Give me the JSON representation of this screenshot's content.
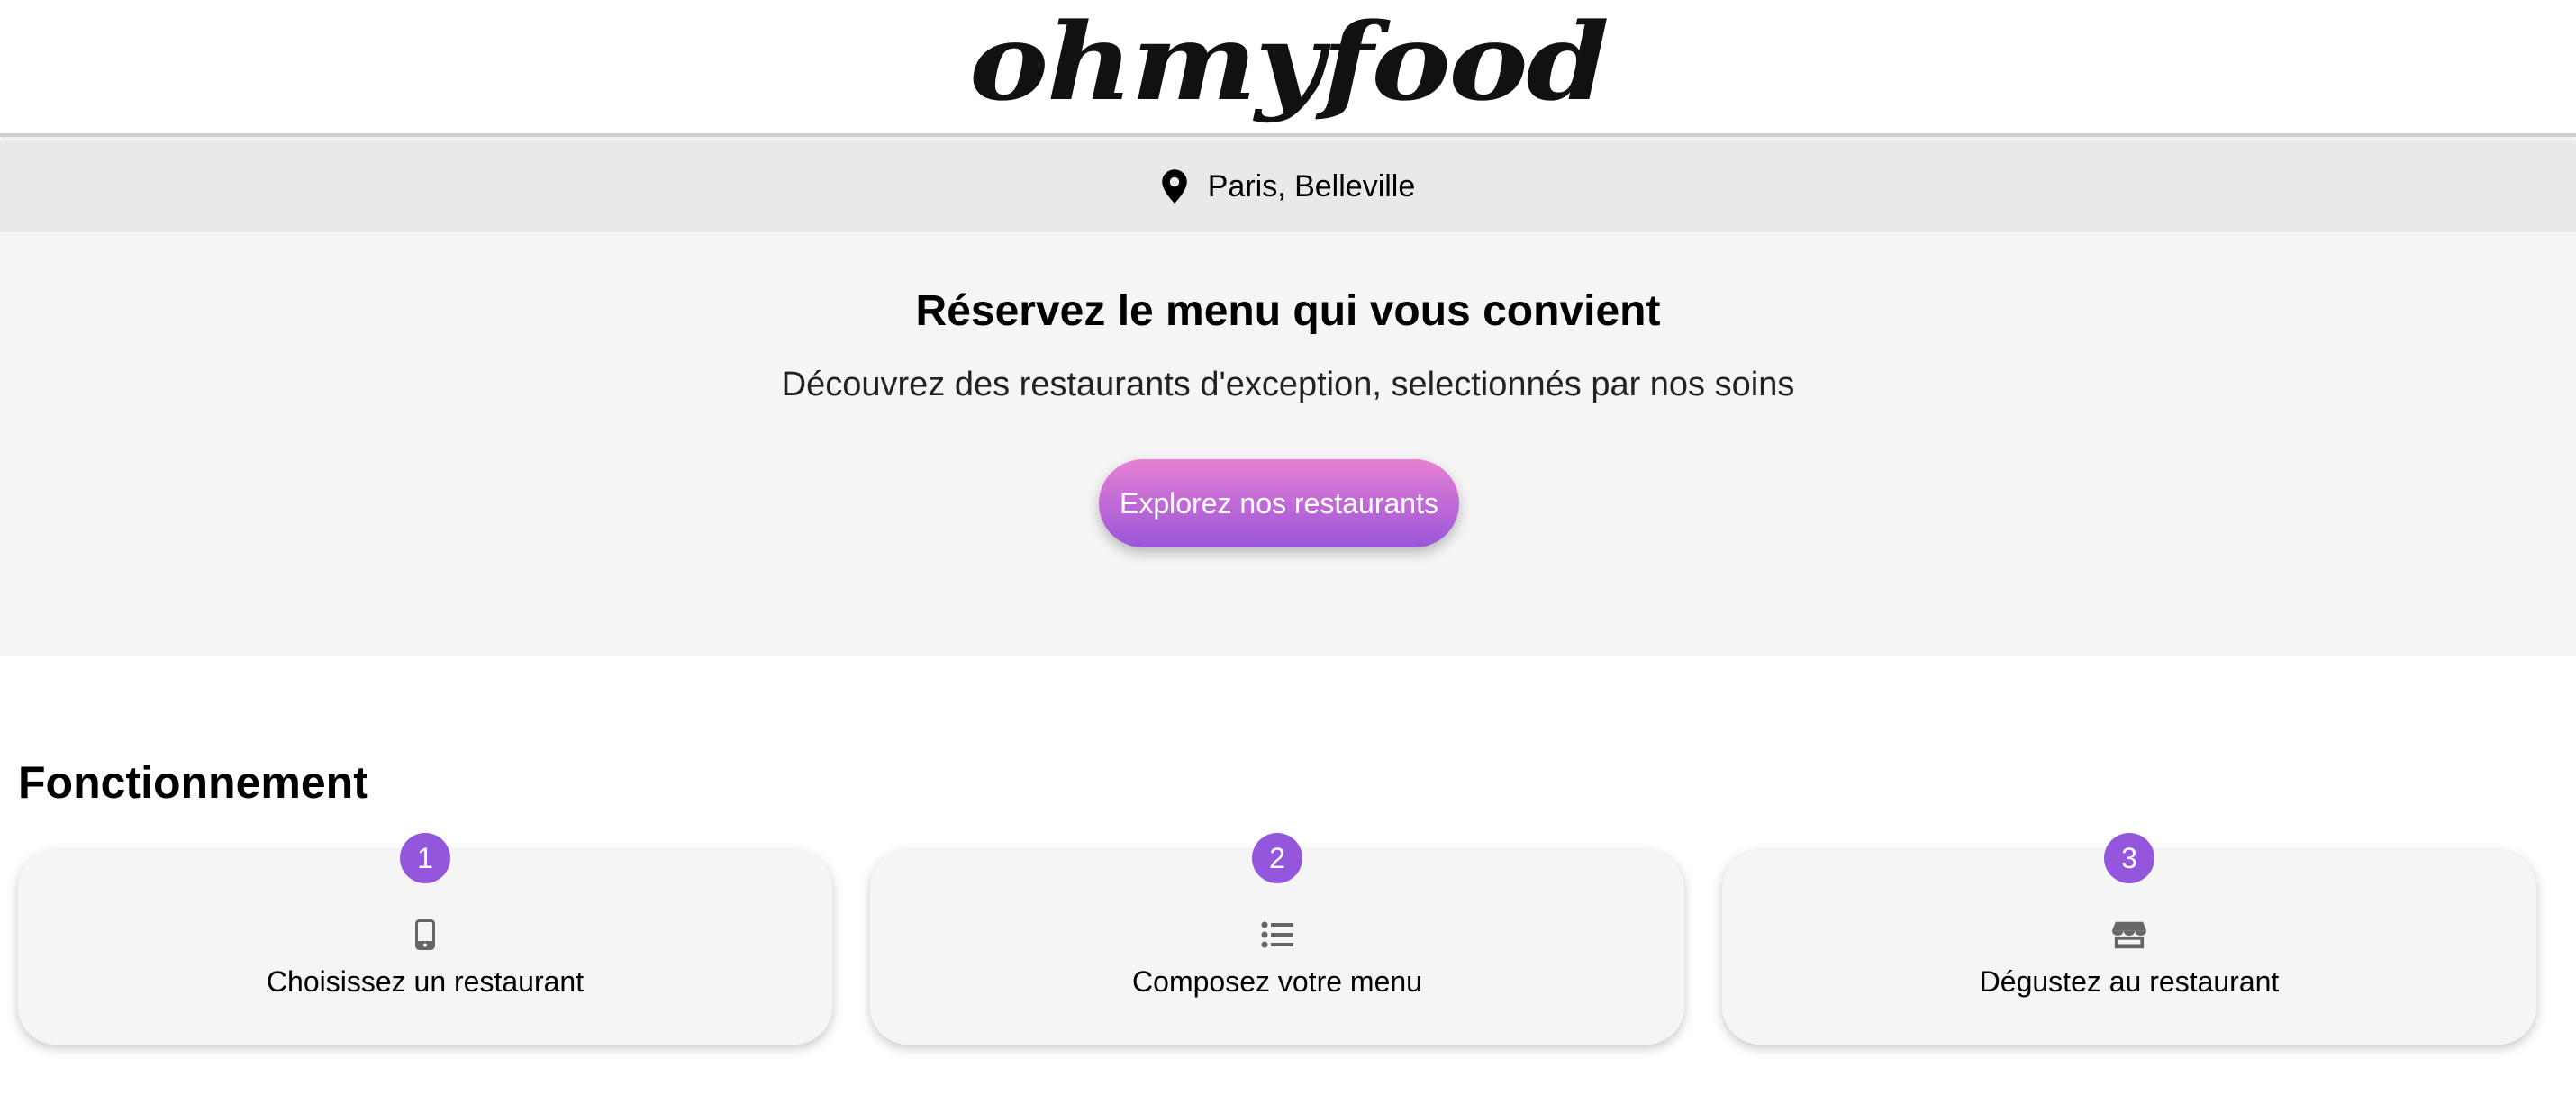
{
  "header": {
    "logo": "ohmyfood"
  },
  "location": {
    "icon": "location-pin-icon",
    "text": "Paris, Belleville"
  },
  "hero": {
    "title": "Réservez le menu qui vous convient",
    "subtitle": "Découvrez des restaurants d'exception, selectionnés par nos soins",
    "cta_label": "Explorez nos restaurants"
  },
  "how_it_works": {
    "title": "Fonctionnement",
    "steps": [
      {
        "number": "1",
        "icon": "smartphone-icon",
        "label": "Choisissez un restaurant"
      },
      {
        "number": "2",
        "icon": "list-icon",
        "label": "Composez votre menu"
      },
      {
        "number": "3",
        "icon": "store-icon",
        "label": "Dégustez au restaurant"
      }
    ]
  },
  "colors": {
    "accent": "#9356dc",
    "cta_gradient_start": "#e780d4",
    "cta_gradient_end": "#9a55d8",
    "location_bar_bg": "#e9e9e9",
    "hero_bg": "#f5f5f5"
  }
}
